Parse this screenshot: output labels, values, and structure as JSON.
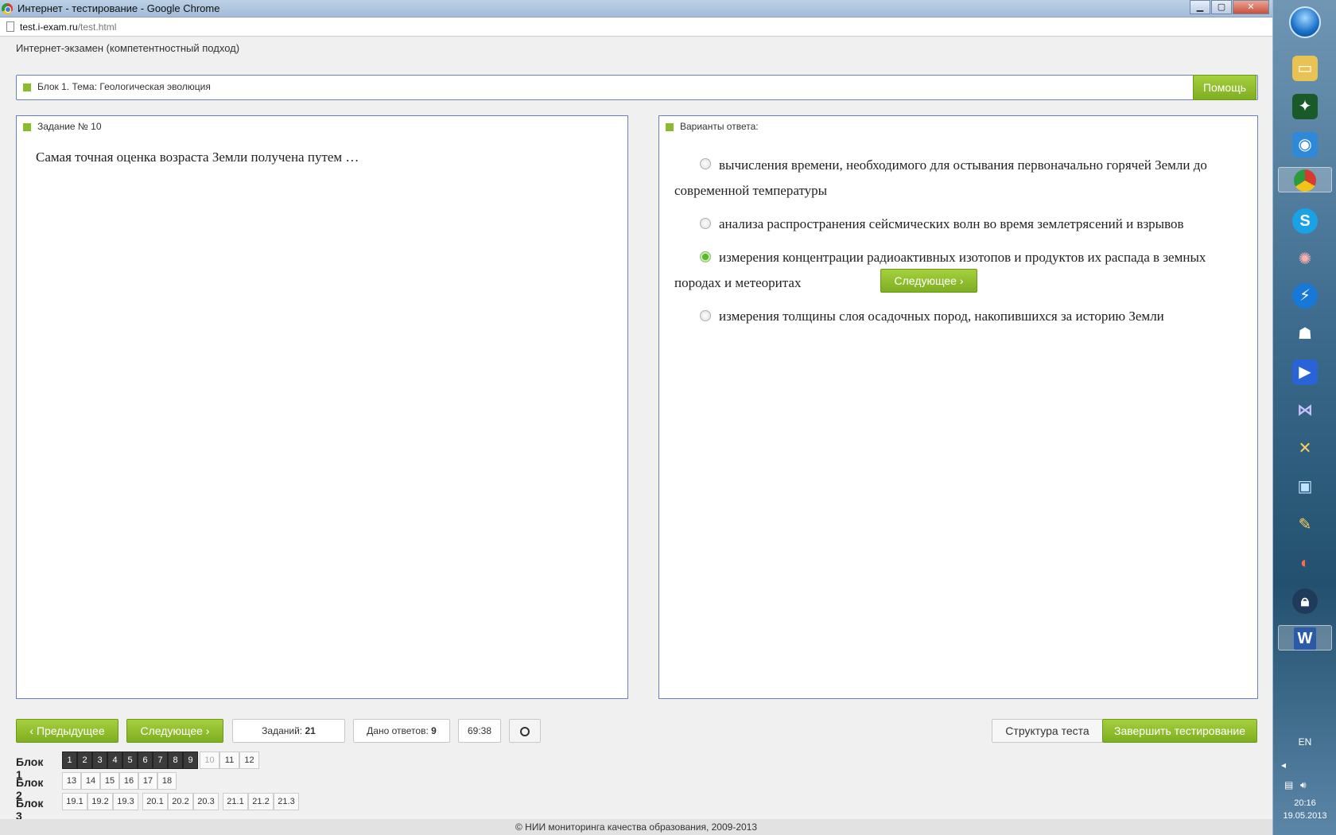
{
  "window": {
    "title": "Интернет - тестирование - Google Chrome",
    "controls": [
      "minimize",
      "maximize",
      "close"
    ]
  },
  "address": {
    "host": "test.i-exam.ru",
    "path": "/test.html"
  },
  "app_title": "Интернет-экзамен (компетентностный подход)",
  "block_header": {
    "label": "Блок 1. Тема: Геологическая эволюция",
    "help_button": "Помощь"
  },
  "task": {
    "header": "Задание № 10",
    "question": "Самая точная оценка возраста Земли получена путем …"
  },
  "answers": {
    "header": "Варианты ответа:",
    "options": [
      {
        "text": "вычисления времени, необходимого для остывания первоначально горячей Земли до современной температуры",
        "selected": false
      },
      {
        "text": "анализа распространения сейсмических волн во время землетрясений и взрывов",
        "selected": false
      },
      {
        "text": "измерения концентрации радиоактивных изотопов и продуктов их распада в земных породах и метеоритах",
        "selected": true
      },
      {
        "text": "измерения толщины слоя осадочных пород, накопившихся за историю Земли",
        "selected": false
      }
    ],
    "inline_next": "Следующее"
  },
  "nav": {
    "prev": "Предыдущее",
    "next": "Следующее",
    "tasks_label": "Заданий:",
    "tasks_count": "21",
    "answered_label": "Дано ответов:",
    "answered_count": "9",
    "timer": "69:38",
    "structure": "Структура теста",
    "finish": "Завершить тестирование"
  },
  "blocks": [
    {
      "label": "Блок 1",
      "items": [
        "1",
        "2",
        "3",
        "4",
        "5",
        "6",
        "7",
        "8",
        "9",
        "10",
        "11",
        "12"
      ],
      "done": 9,
      "current": "10"
    },
    {
      "label": "Блок 2",
      "items": [
        "13",
        "14",
        "15",
        "16",
        "17",
        "18"
      ]
    },
    {
      "label": "Блок 3",
      "items": [
        "19.1",
        "19.2",
        "19.3",
        "20.1",
        "20.2",
        "20.3",
        "21.1",
        "21.2",
        "21.3"
      ]
    }
  ],
  "footer": "© НИИ мониторинга качества образования, 2009-2013",
  "taskbar": {
    "lang": "EN",
    "time": "20:16",
    "date": "19.05.2013"
  }
}
